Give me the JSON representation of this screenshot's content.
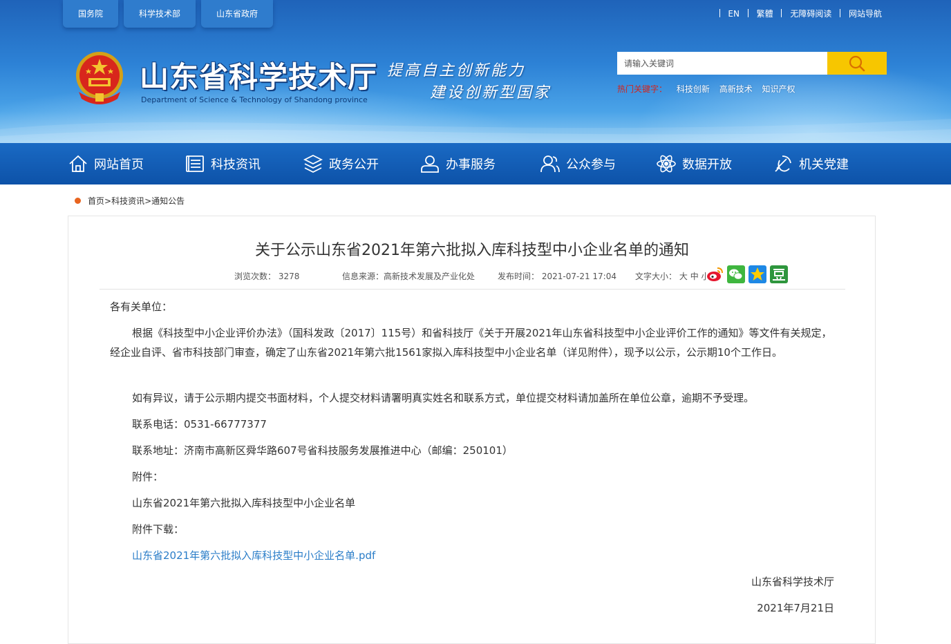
{
  "top_tabs": [
    "国务院",
    "科学技术部",
    "山东省政府"
  ],
  "top_links": [
    "EN",
    "繁體",
    "无障碍阅读",
    "网站导航"
  ],
  "site": {
    "title": "山东省科学技术厅",
    "subtitle": "Department of Science & Technology of Shandong province",
    "slogan_line1": "提高自主创新能力",
    "slogan_line2": "建设创新型国家"
  },
  "search": {
    "placeholder": "请输入关键词"
  },
  "hot_words": {
    "label": "热门关键字：",
    "items": [
      "科技创新",
      "高新技术",
      "知识产权"
    ]
  },
  "nav": [
    {
      "label": "网站首页",
      "icon": "home-icon"
    },
    {
      "label": "科技资讯",
      "icon": "news-icon"
    },
    {
      "label": "政务公开",
      "icon": "layers-icon"
    },
    {
      "label": "办事服务",
      "icon": "user-icon"
    },
    {
      "label": "公众参与",
      "icon": "users-icon"
    },
    {
      "label": "数据开放",
      "icon": "atom-icon"
    },
    {
      "label": "机关党建",
      "icon": "party-icon"
    }
  ],
  "breadcrumb": {
    "home": "首页",
    "section": "科技资讯",
    "current": "通知公告"
  },
  "article": {
    "title": "关于公示山东省2021年第六批拟入库科技型中小企业名单的通知",
    "meta": {
      "views_label": "浏览次数：",
      "views": "3278",
      "source_label": "信息来源：",
      "source": "高新技术发展及产业化处",
      "date_label": "发布时间：",
      "date": "2021-07-21 17:04",
      "font_label": "文字大小：",
      "font_sizes": [
        "大",
        "中",
        "小"
      ]
    },
    "salutation": "各有关单位：",
    "body1": "根据《科技型中小企业评价办法》（国科发政〔2017〕115号）和省科技厅《关于开展2021年山东省科技型中小企业评价工作的通知》等文件有关规定，经企业自评、省市科技部门审查，确定了山东省2021年第六批1561家拟入库科技型中小企业名单（详见附件），现予以公示，公示期10个工作日。",
    "body2": "如有异议，请于公示期内提交书面材料，个人提交材料请署明真实姓名和联系方式，单位提交材料请加盖所在单位公章，逾期不予受理。",
    "phone": "联系电话：0531-66777377",
    "address": "联系地址：济南市高新区舜华路607号省科技服务发展推进中心（邮编：250101）",
    "attachment_label": "附件：",
    "attachment_name": "山东省2021年第六批拟入库科技型中小企业名单",
    "download_label": "附件下载：",
    "download_link": "山东省2021年第六批拟入库科技型中小企业名单.pdf",
    "signature": "山东省科学技术厅",
    "sign_date": "2021年7月21日"
  },
  "colors": {
    "nav_bg": "#0d52a8",
    "search_button": "#f7c600",
    "hot_label": "#d0251e",
    "link": "#2a7dc8",
    "breadcrumb_dot": "#e8641f"
  }
}
